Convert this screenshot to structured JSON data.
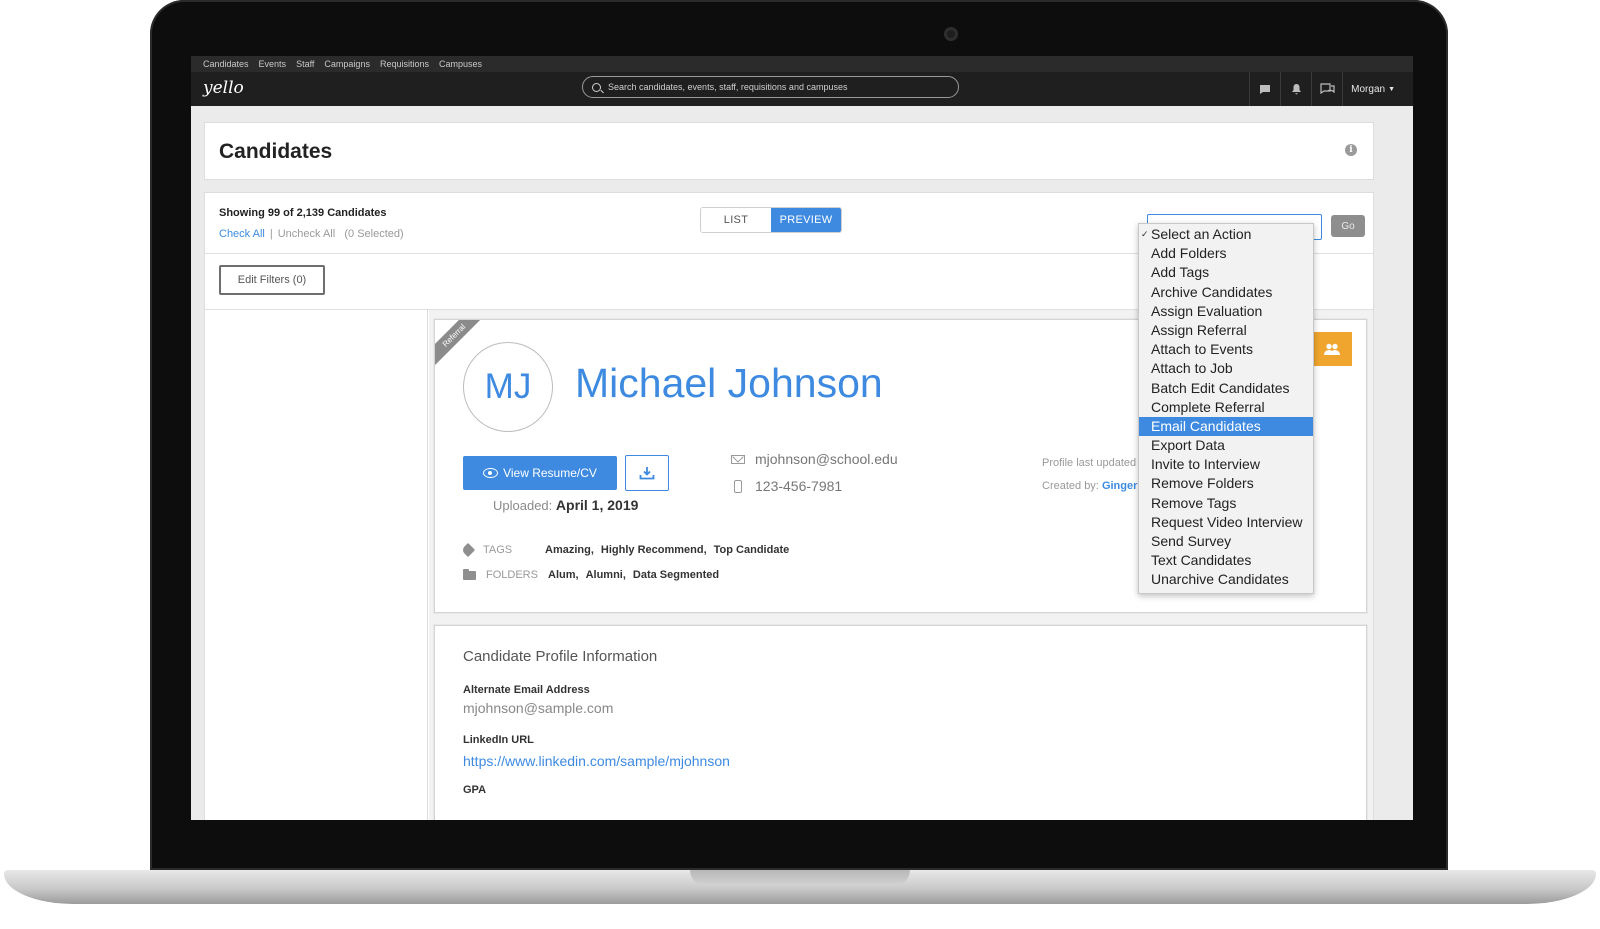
{
  "topnav": [
    "Candidates",
    "Events",
    "Staff",
    "Campaigns",
    "Requisitions",
    "Campuses"
  ],
  "app": {
    "logo": "yello",
    "search_placeholder": "Search candidates, events, staff, requisitions and campuses",
    "user": "Morgan"
  },
  "page": {
    "title": "Candidates",
    "showing": "Showing 99 of 2,139 Candidates",
    "check_all": "Check All",
    "uncheck_all": "Uncheck All",
    "selected": "(0 Selected)",
    "view_list": "LIST",
    "view_preview": "PREVIEW",
    "go": "Go",
    "edit_filters": "Edit Filters (0)"
  },
  "candidate": {
    "ribbon": "Referral",
    "initials": "MJ",
    "name": "Michael Johnson",
    "view_resume": "View Resume/CV",
    "uploaded_label": "Uploaded:",
    "uploaded_date": "April 1, 2019",
    "email": "mjohnson@school.edu",
    "phone": "123-456-7981",
    "updated_label": "Profile last updated",
    "created_label": "Created by:",
    "created_by": "Ginger",
    "tags_label": "TAGS",
    "tags": [
      "Amazing,",
      "Highly Recommend,",
      "Top Candidate"
    ],
    "folders_label": "FOLDERS",
    "folders": [
      "Alum,",
      "Alumni,",
      "Data Segmented"
    ]
  },
  "profile": {
    "title": "Candidate Profile Information",
    "alt_email_label": "Alternate Email Address",
    "alt_email": "mjohnson@sample.com",
    "linkedin_label": "LinkedIn URL",
    "linkedin": "https://www.linkedin.com/sample/mjohnson",
    "gpa_label": "GPA"
  },
  "actions": {
    "checked_index": 0,
    "highlighted_index": 10,
    "items": [
      "Select an Action",
      "Add Folders",
      "Add Tags",
      "Archive Candidates",
      "Assign Evaluation",
      "Assign Referral",
      "Attach to Events",
      "Attach to Job",
      "Batch Edit Candidates",
      "Complete Referral",
      "Email Candidates",
      "Export Data",
      "Invite to Interview",
      "Remove Folders",
      "Remove Tags",
      "Request Video Interview",
      "Send Survey",
      "Text Candidates",
      "Unarchive Candidates"
    ]
  },
  "colors": {
    "accent": "#3d8ae0",
    "orange": "#f0a52e",
    "bezel": "#0d0d0d"
  }
}
